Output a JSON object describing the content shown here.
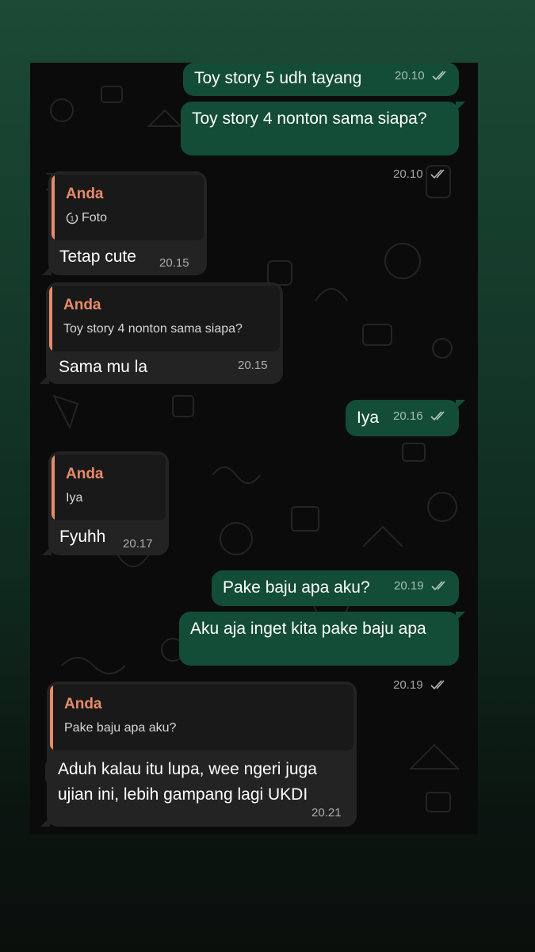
{
  "colors": {
    "outgoing_bubble": "#134d37",
    "incoming_bubble": "#232323",
    "quote_accent": "#e88b6c",
    "read_ticks": "#ffffff"
  },
  "icons": {
    "read_receipt": "double-check-icon",
    "view_once": "view-once-icon"
  },
  "messages": [
    {
      "direction": "outgoing",
      "text": "Toy story 5 udh tayang",
      "time": "20.10",
      "status": "read"
    },
    {
      "direction": "outgoing",
      "text": "Toy story 4 nonton sama siapa?",
      "time": "20.10",
      "status": "read"
    },
    {
      "direction": "incoming",
      "reply_to": {
        "name": "Anda",
        "text": "Foto"
      },
      "text": "Tetap cute",
      "time": "20.15"
    },
    {
      "direction": "incoming",
      "reply_to": {
        "name": "Anda",
        "text": "Toy story 4 nonton sama siapa?"
      },
      "text": "Sama mu la",
      "time": "20.15"
    },
    {
      "direction": "outgoing",
      "text": "Iya",
      "time": "20.16",
      "status": "read"
    },
    {
      "direction": "incoming",
      "reply_to": {
        "name": "Anda",
        "text": "Iya"
      },
      "text": "Fyuhh",
      "time": "20.17"
    },
    {
      "direction": "outgoing",
      "text": "Pake baju apa aku?",
      "time": "20.19",
      "status": "read"
    },
    {
      "direction": "outgoing",
      "text": "Aku aja inget kita pake baju apa",
      "time": "20.19",
      "status": "read"
    },
    {
      "direction": "incoming",
      "reply_to": {
        "name": "Anda",
        "text": "Pake baju apa aku?"
      },
      "text_lines": [
        "Aduh kalau itu lupa, wee ngeri juga",
        "ujian ini, lebih gampang lagi UKDI"
      ],
      "time": "20.21"
    }
  ]
}
